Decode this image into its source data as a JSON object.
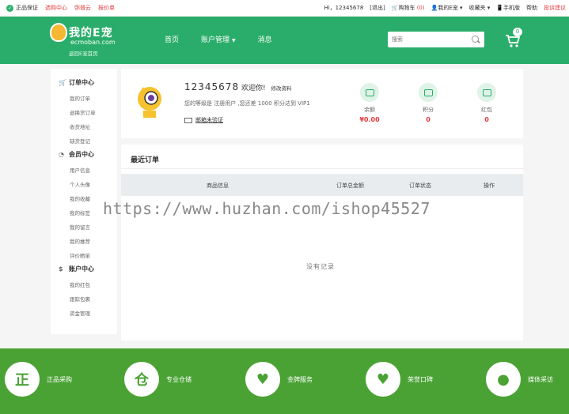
{
  "topbar": {
    "genuine": "正品保证",
    "purchase_center": "选购中心",
    "sign_cloud": "弥普云",
    "quote": "报价单",
    "hi": "Hi，12345678",
    "logout": "[退出]",
    "cart_label": "购物车",
    "cart_count": "(0)",
    "my_account": "我的E宠",
    "favorites": "收藏夹",
    "mobile": "手机版",
    "help": "帮助",
    "complaint": "投诉建议"
  },
  "header": {
    "brand": "我的E宠",
    "domain": "ecmoban.com",
    "back_home": "返回E宠首页",
    "nav": [
      "首页",
      "账户管理",
      "消息"
    ],
    "search_placeholder": "搜索",
    "cart_badge": "0"
  },
  "sidebar": {
    "groups": [
      {
        "title": "订单中心",
        "items": [
          "我的订单",
          "退换货订单",
          "收货地址",
          "缺货登记"
        ]
      },
      {
        "title": "会员中心",
        "items": [
          "用户信息",
          "个人头像",
          "我的收藏",
          "我的标签",
          "我的留言",
          "我的推荐",
          "评价晒单"
        ]
      },
      {
        "title": "账户中心",
        "items": [
          "我的红包",
          "跟踪包裹",
          "资金管理"
        ]
      }
    ]
  },
  "user": {
    "username": "12345678",
    "welcome": "欢迎你!",
    "edit_profile": "修改资料",
    "level_text": "您的等级是 注册用户 ,您还差 1000 积分达到 VIP1",
    "email_verify": "邮箱未验证",
    "stats": [
      {
        "label": "余额",
        "value": "¥0.00"
      },
      {
        "label": "积分",
        "value": "0"
      },
      {
        "label": "红包",
        "value": "0"
      }
    ]
  },
  "orders": {
    "title": "最近订单",
    "columns": [
      "商品信息",
      "订单总金额",
      "订单状态",
      "操作"
    ],
    "empty": "没有记录",
    "watermark": "https://www.huzhan.com/ishop45527"
  },
  "footer": {
    "features": [
      {
        "icon": "正",
        "label": "正品采购"
      },
      {
        "icon": "仓",
        "label": "专业仓储"
      },
      {
        "icon": "♥",
        "label": "金牌服务"
      },
      {
        "icon": "♥",
        "label": "荣誉口碑"
      },
      {
        "icon": "●",
        "label": "媒体采访"
      }
    ]
  },
  "colors": {
    "primary": "#2aad6a",
    "footer": "#4aa234",
    "accent": "#e4393c"
  }
}
